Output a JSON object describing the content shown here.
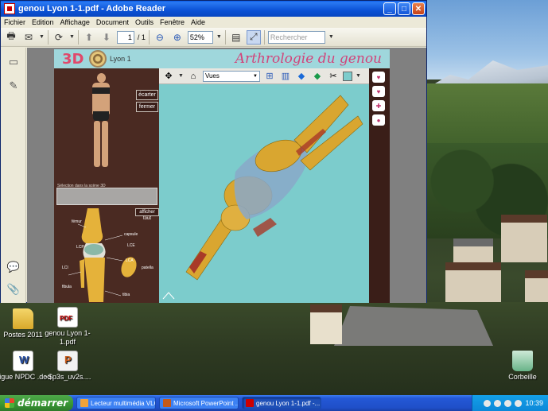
{
  "window": {
    "title": "genou Lyon 1-1.pdf - Adobe Reader",
    "controls": {
      "minimize": "_",
      "maximize": "□",
      "close": "✕"
    }
  },
  "menu": [
    "Fichier",
    "Edition",
    "Affichage",
    "Document",
    "Outils",
    "Fenêtre",
    "Aide"
  ],
  "toolbar": {
    "page_current": "1",
    "page_total": "/ 1",
    "zoom": "52%",
    "search_placeholder": "Rechercher"
  },
  "document": {
    "logo_text": "3D",
    "subtitle": "Lyon 1",
    "title": "Arthrologie du genou",
    "buttons": {
      "spread": "écarter",
      "close": "fermer",
      "show_all": "afficher tout"
    },
    "selection_label": "Sélection dans la scène 3D",
    "anatomy_labels": {
      "femur": "fémur",
      "capsule": "capsule",
      "lce": "LCE",
      "lcp": "LCP",
      "lca": "LCA",
      "lci": "LCI",
      "patella": "patella",
      "fibula": "fibula",
      "tibia": "tibia"
    }
  },
  "viewer": {
    "view_select": "Vues",
    "background_color": "#7ccccc"
  },
  "desktop_icons": [
    {
      "label": "Postes 2011",
      "icon": "folder-icon"
    },
    {
      "label": "genou Lyon 1-1.pdf",
      "icon": "pdf-file-icon"
    },
    {
      "label": "Ligue NPDC .doc",
      "icon": "word-file-icon"
    },
    {
      "label": "~$p3s_uv2s....",
      "icon": "powerpoint-file-icon"
    },
    {
      "label": "Corbeille",
      "icon": "recycle-bin-icon"
    }
  ],
  "taskbar": {
    "start": "démarrer",
    "tasks": [
      {
        "label": "Lecteur multimédia VLC",
        "active": false
      },
      {
        "label": "Microsoft PowerPoint ...",
        "active": false
      },
      {
        "label": "genou Lyon 1-1.pdf -...",
        "active": true
      }
    ],
    "clock": "10:39"
  },
  "colors": {
    "page_background": "#4a2a22",
    "banner": "#9fd7dc",
    "title_pink": "#d2447a",
    "bone": "#d9a630",
    "cartilage": "#8aa8c8",
    "muscle": "#a83a28"
  }
}
